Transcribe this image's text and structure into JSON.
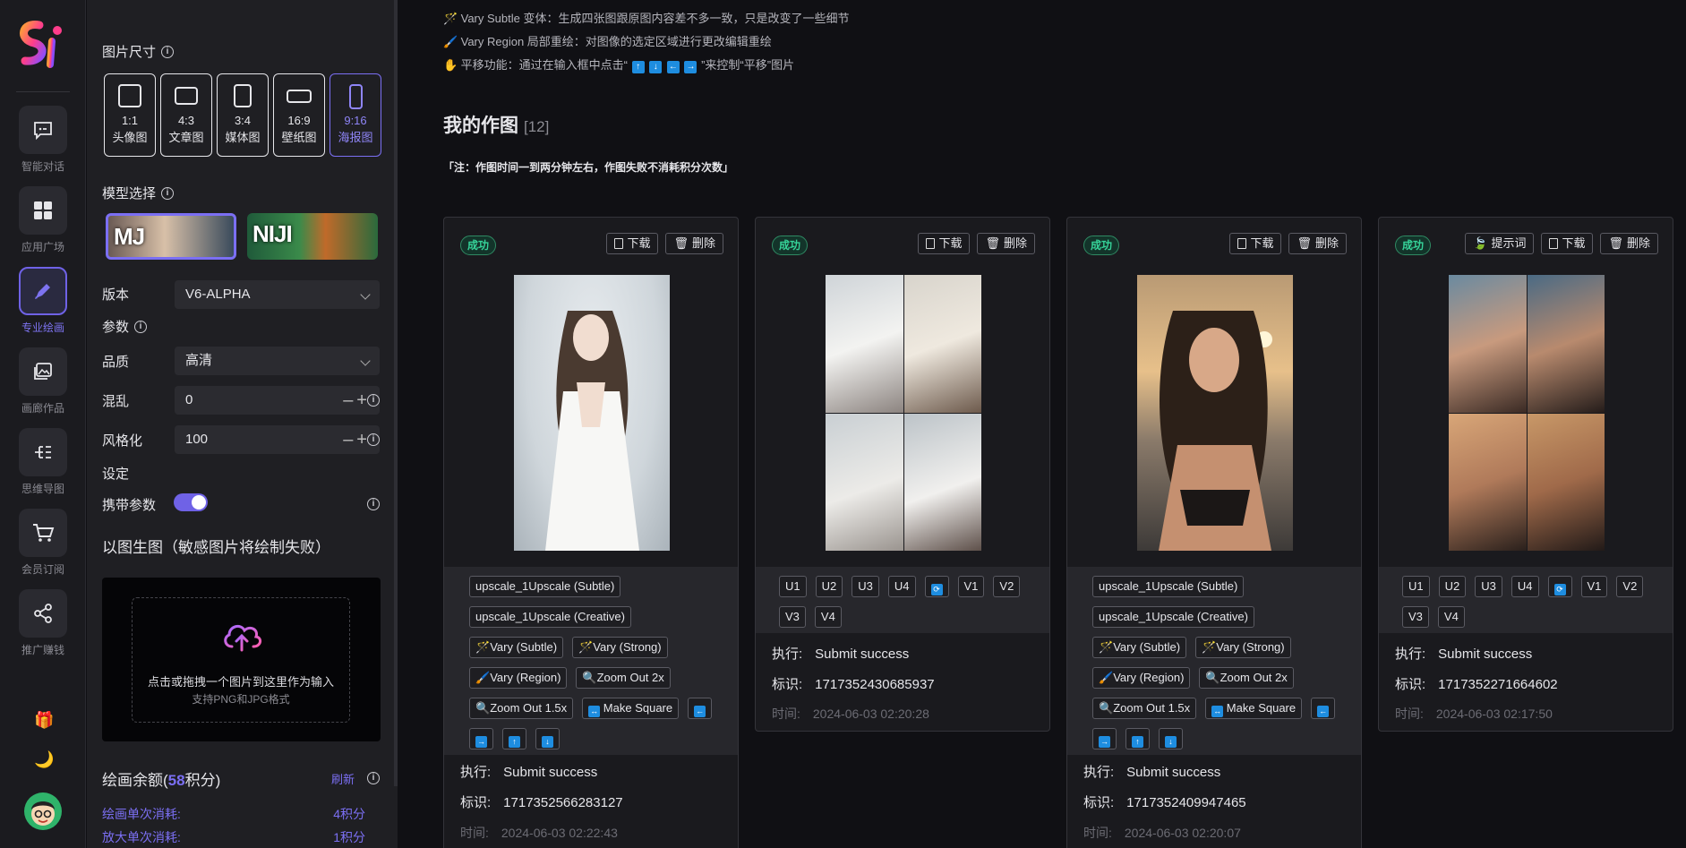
{
  "rail": {
    "items": [
      {
        "label": "智能对话",
        "icon": "chat-icon"
      },
      {
        "label": "应用广场",
        "icon": "grid-icon"
      },
      {
        "label": "专业绘画",
        "icon": "paint-icon"
      },
      {
        "label": "画廊作品",
        "icon": "gallery-icon"
      },
      {
        "label": "思维导图",
        "icon": "mindmap-icon"
      },
      {
        "label": "会员订阅",
        "icon": "cart-icon"
      },
      {
        "label": "推广赚钱",
        "icon": "share-icon"
      }
    ]
  },
  "panel": {
    "size_title": "图片尺寸",
    "ratios": [
      {
        "ratio": "1:1",
        "name": "头像图"
      },
      {
        "ratio": "4:3",
        "name": "文章图"
      },
      {
        "ratio": "3:4",
        "name": "媒体图"
      },
      {
        "ratio": "16:9",
        "name": "壁纸图"
      },
      {
        "ratio": "9:16",
        "name": "海报图"
      }
    ],
    "model_title": "模型选择",
    "models": [
      {
        "label": "MJ"
      },
      {
        "label": "NIJI"
      }
    ],
    "version_label": "版本",
    "version_value": "V6-ALPHA",
    "params_label": "参数",
    "quality_label": "品质",
    "quality_value": "高清",
    "chaos_label": "混乱",
    "chaos_value": "0",
    "stylize_label": "风格化",
    "stylize_value": "100",
    "settings_label": "设定",
    "carry_label": "携带参数",
    "img2img_title": "以图生图（敏感图片将绘制失败）",
    "upload_text": "点击或拖拽一个图片到这里作为输入",
    "upload_hint": "支持PNG和JPG格式",
    "balance_prefix": "绘画余额(",
    "balance_value": "58",
    "balance_suffix": "积分)",
    "refresh_label": "刷新",
    "costs": [
      {
        "label": "绘画单次消耗:",
        "value": "4积分"
      },
      {
        "label": "放大单次消耗:",
        "value": "1积分"
      }
    ]
  },
  "main": {
    "tips": [
      {
        "icon": "🪄",
        "text": "Vary Subtle 变体：生成四张图跟原图内容差不多一致，只是改变了一些细节"
      },
      {
        "icon": "🖌️",
        "text": "Vary Region 局部重绘：对图像的选定区域进行更改编辑重绘"
      },
      {
        "icon": "✋",
        "text_before": "平移功能：通过在输入框中点击“",
        "text_after": "”来控制“平移”图片"
      }
    ],
    "title": "我的作图",
    "count": "[12]",
    "note": "「注：作图时间一到两分钟左右，作图失败不消耗积分次数」",
    "status_label": "成功",
    "download_label": "下载",
    "delete_label": "删除",
    "prompt_label": "提示词",
    "exec_key": "执行:",
    "id_key": "标识:",
    "time_key": "时间:",
    "cards": [
      {
        "exec": "Submit success",
        "id": "1717352566283127",
        "time": "2024-06-03 02:22:43"
      },
      {
        "exec": "Submit success",
        "id": "1717352430685937",
        "time": "2024-06-03 02:20:28"
      },
      {
        "exec": "Submit success",
        "id": "1717352409947465",
        "time": "2024-06-03 02:20:07"
      },
      {
        "exec": "Submit success",
        "id": "1717352271664602",
        "time": "2024-06-03 02:17:50"
      }
    ],
    "upscale_actions": [
      "upscale_1Upscale (Subtle)",
      "upscale_1Upscale (Creative)",
      "Vary (Subtle)",
      "Vary (Strong)",
      "Vary (Region)",
      "Zoom Out 2x",
      "Zoom Out 1.5x",
      "Make Square"
    ],
    "grid_actions": [
      "U1",
      "U2",
      "U3",
      "U4",
      "V1",
      "V2",
      "V3",
      "V4"
    ]
  },
  "colors": {
    "accent": "#7b6ff3",
    "success": "#36d399",
    "arrow": "#1e8de0"
  }
}
